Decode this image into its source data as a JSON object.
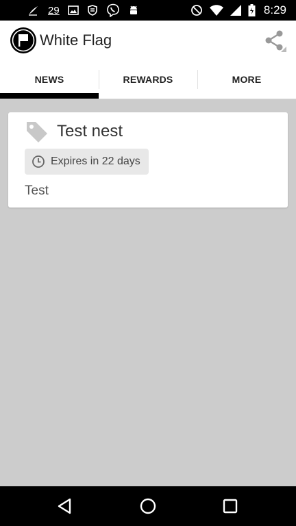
{
  "status_bar": {
    "notification_count": "29",
    "time": "8:29",
    "icons": [
      "feather-icon",
      "picture-icon",
      "shield-icon",
      "viber-icon",
      "android-icon",
      "blocked-icon",
      "wifi-icon",
      "signal-icon",
      "battery-icon"
    ]
  },
  "app_bar": {
    "title": "White Flag",
    "logo_icon": "white-flag-logo",
    "action_icon": "share-icon"
  },
  "tabs": [
    {
      "label": "NEWS",
      "active": true
    },
    {
      "label": "REWARDS",
      "active": false
    },
    {
      "label": "MORE",
      "active": false
    }
  ],
  "news": [
    {
      "icon": "tag-icon",
      "title": "Test nest",
      "expiry": "Expires in 22 days",
      "body": "Test"
    }
  ],
  "nav_bar": {
    "icons": [
      "back-icon",
      "home-icon",
      "recents-icon"
    ]
  },
  "colors": {
    "status_bar": "#000000",
    "app_bar": "#ffffff",
    "content_bg": "#cccccc",
    "tab_indicator": "#000000",
    "chip_bg": "#e8e8e8"
  }
}
